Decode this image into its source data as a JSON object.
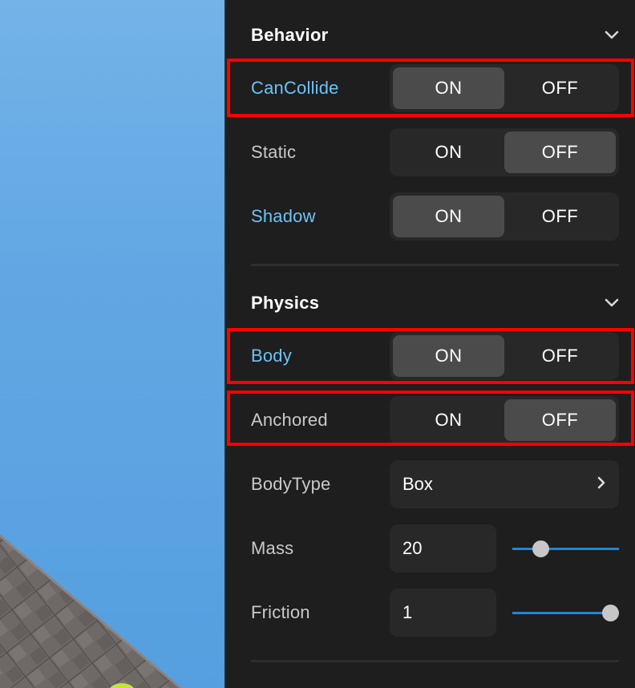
{
  "sections": {
    "behavior": {
      "title": "Behavior"
    },
    "physics": {
      "title": "Physics"
    }
  },
  "rows": {
    "cancollide": {
      "label": "CanCollide",
      "on": "ON",
      "off": "OFF",
      "value": "ON"
    },
    "static": {
      "label": "Static",
      "on": "ON",
      "off": "OFF",
      "value": "OFF"
    },
    "shadow": {
      "label": "Shadow",
      "on": "ON",
      "off": "OFF",
      "value": "ON"
    },
    "body": {
      "label": "Body",
      "on": "ON",
      "off": "OFF",
      "value": "ON"
    },
    "anchored": {
      "label": "Anchored",
      "on": "ON",
      "off": "OFF",
      "value": "OFF"
    },
    "bodytype": {
      "label": "BodyType",
      "value": "Box"
    },
    "mass": {
      "label": "Mass",
      "value": "20",
      "slider_fraction": 0.26
    },
    "friction": {
      "label": "Friction",
      "value": "1",
      "slider_fraction": 0.92
    }
  },
  "colors": {
    "panel_bg": "#1e1e1e",
    "label_modified": "#6cc3f5",
    "label_default": "#c9c9c9",
    "slider_track": "#1e87d6",
    "highlight": "#ff0000"
  }
}
